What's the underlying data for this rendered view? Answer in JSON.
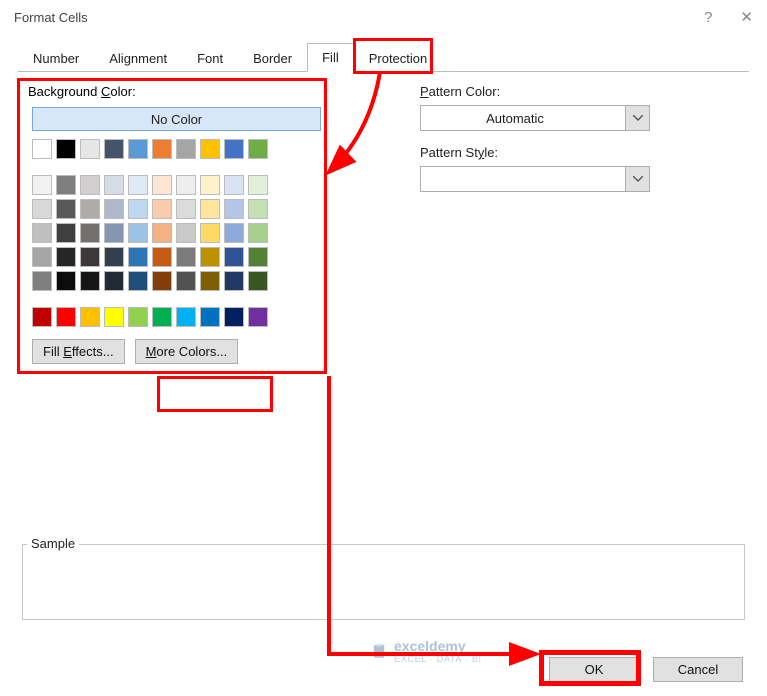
{
  "window": {
    "title": "Format Cells",
    "help_icon": "?",
    "close_icon": "✕"
  },
  "tabs": {
    "items": [
      {
        "label": "Number"
      },
      {
        "label": "Alignment"
      },
      {
        "label": "Font"
      },
      {
        "label": "Border"
      },
      {
        "label": "Fill"
      },
      {
        "label": "Protection"
      }
    ],
    "active": "Fill"
  },
  "fill": {
    "background_label_pre": "Background ",
    "background_label_ul": "C",
    "background_label_post": "olor:",
    "no_color": "No Color",
    "pattern_color_ul": "P",
    "pattern_color_post": "attern Color:",
    "pattern_color_value": "Automatic",
    "pattern_style_pre": "Pattern St",
    "pattern_style_ul": "y",
    "pattern_style_post": "le:",
    "pattern_style_value": "",
    "fill_effects_pre": "Fill ",
    "fill_effects_ul": "E",
    "fill_effects_post": "ffects...",
    "more_colors_ul": "M",
    "more_colors_post": "ore Colors...",
    "colors_row1": [
      "#ffffff",
      "#000000",
      "#e7e6e6",
      "#44546a",
      "#5b9bd5",
      "#ed7d31",
      "#a5a5a5",
      "#ffc000",
      "#4472c4",
      "#70ad47"
    ],
    "colors_main": [
      [
        "#f2f2f2",
        "#7f7f7f",
        "#d0cece",
        "#d6dce4",
        "#deebf6",
        "#fbe5d5",
        "#ededed",
        "#fff2cc",
        "#d9e2f3",
        "#e2efd9"
      ],
      [
        "#d8d8d8",
        "#595959",
        "#aeabab",
        "#adb9ca",
        "#bdd7ee",
        "#f7cbac",
        "#dbdbdb",
        "#fee599",
        "#b4c6e7",
        "#c5e0b3"
      ],
      [
        "#bfbfbf",
        "#3f3f3f",
        "#757070",
        "#8496b0",
        "#9cc3e5",
        "#f4b183",
        "#c9c9c9",
        "#ffd965",
        "#8eaadb",
        "#a8d08d"
      ],
      [
        "#a5a5a5",
        "#262626",
        "#3a3838",
        "#323f4f",
        "#2e75b5",
        "#c55a11",
        "#7b7b7b",
        "#bf9000",
        "#2f5496",
        "#538135"
      ],
      [
        "#7f7f7f",
        "#0c0c0c",
        "#171616",
        "#222a35",
        "#1e4e79",
        "#833c0b",
        "#525252",
        "#7f6000",
        "#1f3864",
        "#375623"
      ]
    ],
    "colors_std": [
      "#c00000",
      "#ff0000",
      "#ffc000",
      "#ffff00",
      "#92d050",
      "#00b050",
      "#00b0f0",
      "#0070c0",
      "#002060",
      "#7030a0"
    ]
  },
  "sample_label": "Sample",
  "footer": {
    "ok": "OK",
    "cancel": "Cancel"
  },
  "watermark": {
    "brand": "exceldemy",
    "caption": "EXCEL · DATA · BI"
  }
}
